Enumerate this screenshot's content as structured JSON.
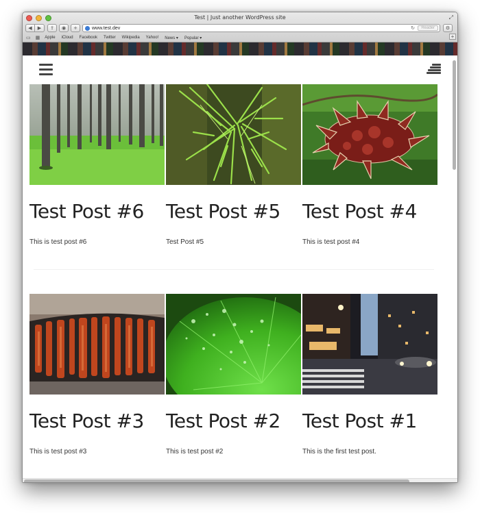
{
  "window": {
    "title": "Test | Just another WordPress site",
    "url": "www.test.dev",
    "reader_label": "Reader"
  },
  "toolbar": {
    "back": "◀",
    "forward": "▶",
    "share": "⇪",
    "history": "◉",
    "new_tab": "+",
    "settings": "⚙",
    "reload": "↻"
  },
  "bookmarks": [
    {
      "label": "Apple"
    },
    {
      "label": "iCloud"
    },
    {
      "label": "Facebook"
    },
    {
      "label": "Twitter"
    },
    {
      "label": "Wikipedia"
    },
    {
      "label": "Yahoo!"
    },
    {
      "label": "News ▾"
    },
    {
      "label": "Popular ▾"
    }
  ],
  "posts": [
    {
      "title": "Test Post #6",
      "excerpt": "This is test post #6",
      "image": "pine-forest"
    },
    {
      "title": "Test Post #5",
      "excerpt": "Test Post #5",
      "image": "green-fern-leaves"
    },
    {
      "title": "Test Post #4",
      "excerpt": "This is test post #4",
      "image": "red-seed-pod"
    },
    {
      "title": "Test Post #3",
      "excerpt": "This is test post #3",
      "image": "burnt-bark"
    },
    {
      "title": "Test Post #2",
      "excerpt": "This is test post #2",
      "image": "green-leaf-water-drops"
    },
    {
      "title": "Test Post #1",
      "excerpt": "This is the first test post.",
      "image": "city-street-night"
    }
  ],
  "colors": {
    "title_text": "#222222",
    "body_text": "#333333",
    "icon": "#444444"
  }
}
